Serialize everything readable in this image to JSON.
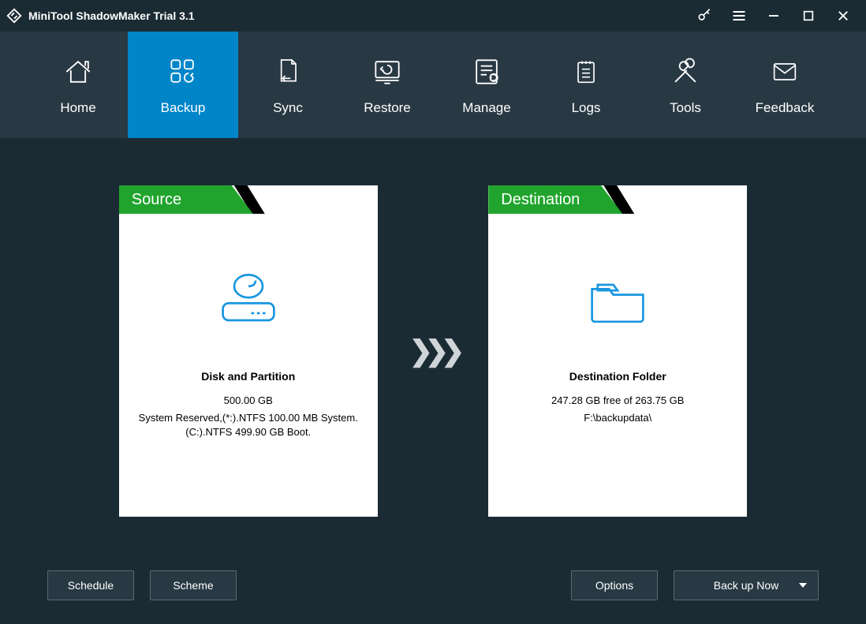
{
  "app": {
    "title": "MiniTool ShadowMaker Trial 3.1"
  },
  "nav": {
    "items": [
      {
        "label": "Home"
      },
      {
        "label": "Backup"
      },
      {
        "label": "Sync"
      },
      {
        "label": "Restore"
      },
      {
        "label": "Manage"
      },
      {
        "label": "Logs"
      },
      {
        "label": "Tools"
      },
      {
        "label": "Feedback"
      }
    ]
  },
  "source": {
    "tab_label": "Source",
    "heading": "Disk and Partition",
    "size": "500.00 GB",
    "detail": "System Reserved,(*:).NTFS 100.00 MB System. (C:).NTFS 499.90 GB Boot."
  },
  "destination": {
    "tab_label": "Destination",
    "heading": "Destination Folder",
    "free": "247.28 GB free of 263.75 GB",
    "path": "F:\\backupdata\\"
  },
  "buttons": {
    "schedule": "Schedule",
    "scheme": "Scheme",
    "options": "Options",
    "backup_now": "Back up Now"
  }
}
